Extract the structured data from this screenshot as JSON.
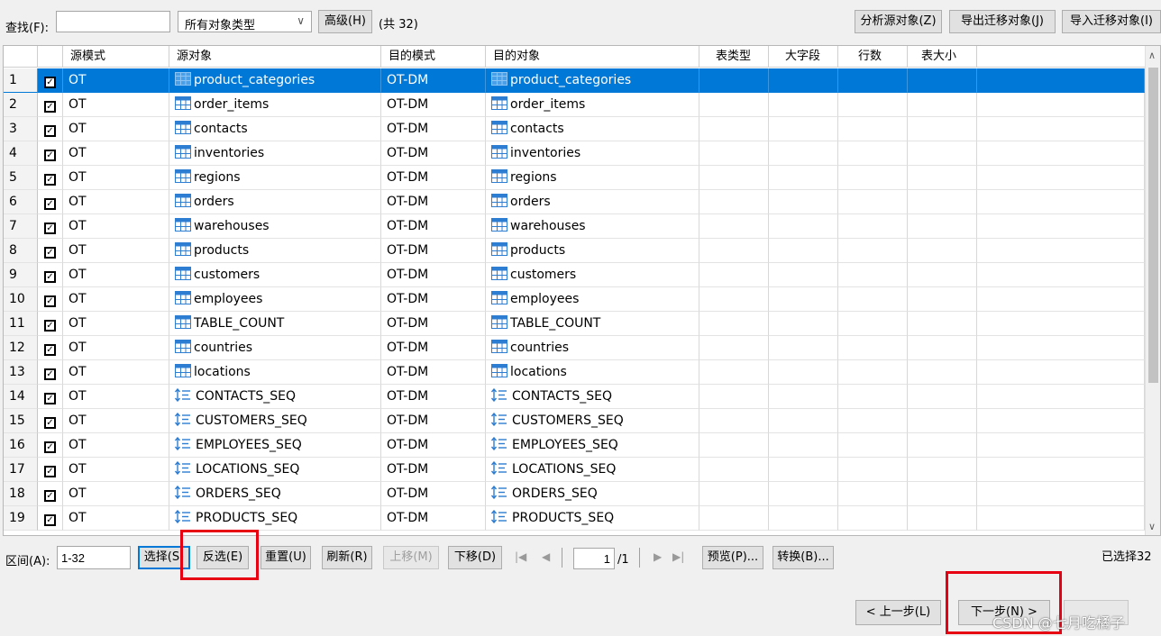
{
  "toolbar": {
    "find_label": "查找(F):",
    "find_value": "",
    "type_filter": "所有对象类型",
    "advanced_button": "高级(H)",
    "total_count": "(共 32)",
    "analyze_button": "分析源对象(Z)",
    "export_button": "导出迁移对象(J)",
    "import_button": "导入迁移对象(I)"
  },
  "table": {
    "columns": [
      "源模式",
      "源对象",
      "目的模式",
      "目的对象",
      "表类型",
      "大字段",
      "行数",
      "表大小"
    ],
    "rows": [
      {
        "num": "1",
        "src_schema": "OT",
        "src_obj": "product_categories",
        "dst_schema": "OT-DM",
        "dst_obj": "product_categories",
        "kind": "table",
        "selected": true
      },
      {
        "num": "2",
        "src_schema": "OT",
        "src_obj": "order_items",
        "dst_schema": "OT-DM",
        "dst_obj": "order_items",
        "kind": "table"
      },
      {
        "num": "3",
        "src_schema": "OT",
        "src_obj": "contacts",
        "dst_schema": "OT-DM",
        "dst_obj": "contacts",
        "kind": "table"
      },
      {
        "num": "4",
        "src_schema": "OT",
        "src_obj": "inventories",
        "dst_schema": "OT-DM",
        "dst_obj": "inventories",
        "kind": "table"
      },
      {
        "num": "5",
        "src_schema": "OT",
        "src_obj": "regions",
        "dst_schema": "OT-DM",
        "dst_obj": "regions",
        "kind": "table"
      },
      {
        "num": "6",
        "src_schema": "OT",
        "src_obj": "orders",
        "dst_schema": "OT-DM",
        "dst_obj": "orders",
        "kind": "table"
      },
      {
        "num": "7",
        "src_schema": "OT",
        "src_obj": "warehouses",
        "dst_schema": "OT-DM",
        "dst_obj": "warehouses",
        "kind": "table"
      },
      {
        "num": "8",
        "src_schema": "OT",
        "src_obj": "products",
        "dst_schema": "OT-DM",
        "dst_obj": "products",
        "kind": "table"
      },
      {
        "num": "9",
        "src_schema": "OT",
        "src_obj": "customers",
        "dst_schema": "OT-DM",
        "dst_obj": "customers",
        "kind": "table"
      },
      {
        "num": "10",
        "src_schema": "OT",
        "src_obj": "employees",
        "dst_schema": "OT-DM",
        "dst_obj": "employees",
        "kind": "table"
      },
      {
        "num": "11",
        "src_schema": "OT",
        "src_obj": "TABLE_COUNT",
        "dst_schema": "OT-DM",
        "dst_obj": "TABLE_COUNT",
        "kind": "table"
      },
      {
        "num": "12",
        "src_schema": "OT",
        "src_obj": "countries",
        "dst_schema": "OT-DM",
        "dst_obj": "countries",
        "kind": "table"
      },
      {
        "num": "13",
        "src_schema": "OT",
        "src_obj": "locations",
        "dst_schema": "OT-DM",
        "dst_obj": "locations",
        "kind": "table"
      },
      {
        "num": "14",
        "src_schema": "OT",
        "src_obj": "CONTACTS_SEQ",
        "dst_schema": "OT-DM",
        "dst_obj": "CONTACTS_SEQ",
        "kind": "sequence"
      },
      {
        "num": "15",
        "src_schema": "OT",
        "src_obj": "CUSTOMERS_SEQ",
        "dst_schema": "OT-DM",
        "dst_obj": "CUSTOMERS_SEQ",
        "kind": "sequence"
      },
      {
        "num": "16",
        "src_schema": "OT",
        "src_obj": "EMPLOYEES_SEQ",
        "dst_schema": "OT-DM",
        "dst_obj": "EMPLOYEES_SEQ",
        "kind": "sequence"
      },
      {
        "num": "17",
        "src_schema": "OT",
        "src_obj": "LOCATIONS_SEQ",
        "dst_schema": "OT-DM",
        "dst_obj": "LOCATIONS_SEQ",
        "kind": "sequence"
      },
      {
        "num": "18",
        "src_schema": "OT",
        "src_obj": "ORDERS_SEQ",
        "dst_schema": "OT-DM",
        "dst_obj": "ORDERS_SEQ",
        "kind": "sequence"
      },
      {
        "num": "19",
        "src_schema": "OT",
        "src_obj": "PRODUCTS_SEQ",
        "dst_schema": "OT-DM",
        "dst_obj": "PRODUCTS_SEQ",
        "kind": "sequence"
      }
    ]
  },
  "bottom_bar": {
    "range_label": "区间(A):",
    "range_value": "1-32",
    "select_button": "选择(S)",
    "invert_button": "反选(E)",
    "reset_button": "重置(U)",
    "refresh_button": "刷新(R)",
    "move_up_button": "上移(M)",
    "move_down_button": "下移(D)",
    "page_value": "1",
    "page_total": "/1",
    "preview_button": "预览(P)...",
    "convert_button": "转换(B)...",
    "selected_count": "已选择32"
  },
  "nav": {
    "prev_button": "< 上一步(L)",
    "next_button": "下一步(N) >",
    "watermark": "CSDN @七月吃橘子"
  },
  "colors": {
    "selection": "#0078d7",
    "highlight_box": "#e60012"
  }
}
